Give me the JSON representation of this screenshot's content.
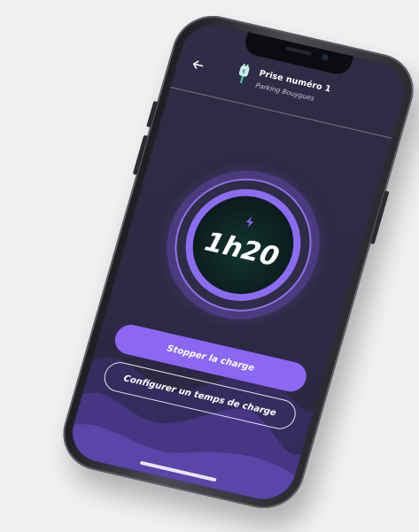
{
  "header": {
    "title": "Prise numéro 1",
    "subtitle": "Parking Bouygues",
    "back_icon": "arrow-left-icon",
    "plug_icon": "ev-plug-icon"
  },
  "charge": {
    "time": "1h20",
    "bolt_icon": "lightning-bolt-icon"
  },
  "actions": {
    "stop_label": "Stopper la charge",
    "configure_label": "Configurer un temps de charge"
  },
  "colors": {
    "background": "#2f2c45",
    "accent": "#8b67f3",
    "ring_glow": "#4a3b7e",
    "gauge_center": "#0d1f1f"
  }
}
